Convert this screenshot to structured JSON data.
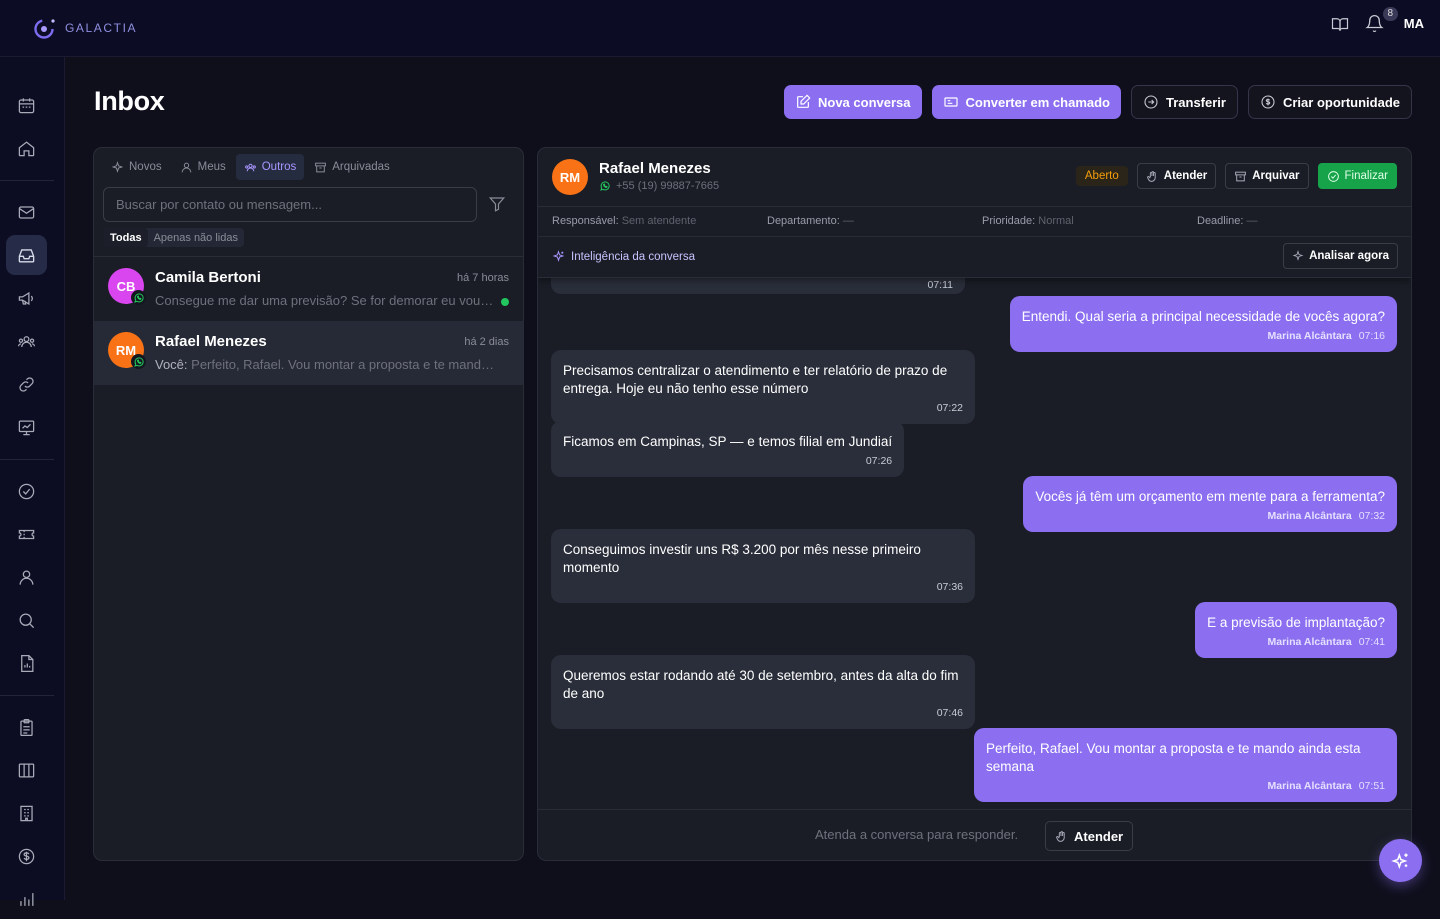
{
  "app": {
    "brand": "GALACTIA"
  },
  "topbar": {
    "notification_count": "8",
    "user_initials": "MA"
  },
  "page": {
    "title": "Inbox"
  },
  "actions": {
    "new_conversation": "Nova conversa",
    "convert_ticket": "Converter em chamado",
    "transfer": "Transferir",
    "create_opportunity": "Criar oportunidade"
  },
  "inbox": {
    "tabs": [
      {
        "label": "Novos",
        "icon": "sparkle-icon"
      },
      {
        "label": "Meus",
        "icon": "user-icon"
      },
      {
        "label": "Outros",
        "icon": "users-icon"
      },
      {
        "label": "Arquivadas",
        "icon": "archive-icon"
      }
    ],
    "active_tab": "Outros",
    "search_placeholder": "Buscar por contato ou mensagem...",
    "filters": {
      "all": "Todas",
      "unread": "Apenas não lidas"
    },
    "conversations": [
      {
        "initials": "CB",
        "name": "Camila Bertoni",
        "time": "há 7 horas",
        "preview_prefix": "",
        "preview": "Consegue me dar uma previsão? Se for demorar eu vou procurar outra opção",
        "unread": true,
        "avatar_color": "#d946ef",
        "channel": "whatsapp-icon"
      },
      {
        "initials": "RM",
        "name": "Rafael Menezes",
        "time": "há 2 dias",
        "preview_prefix": "Você:",
        "preview": " Perfeito, Rafael. Vou montar a proposta e te mando ainda esta semana",
        "unread": false,
        "avatar_color": "#f97316",
        "channel": "whatsapp-icon"
      }
    ]
  },
  "chat": {
    "contact": {
      "initials": "RM",
      "name": "Rafael Menezes",
      "phone": "+55 (19) 99887-7665"
    },
    "status": "Aberto",
    "buttons": {
      "attend": "Atender",
      "archive": "Arquivar",
      "finish": "Finalizar"
    },
    "meta": [
      {
        "label": "Responsável:",
        "value": "Sem atendente"
      },
      {
        "label": "Departamento:",
        "value": "—"
      },
      {
        "label": "Prioridade:",
        "value": "Normal"
      },
      {
        "label": "Deadline:",
        "value": "—"
      }
    ],
    "intel": {
      "label": "Inteligência da conversa",
      "button": "Analisar agora"
    },
    "messages": [
      {
        "dir": "in",
        "text": "",
        "time": "07:11"
      },
      {
        "dir": "out",
        "text": "Entendi. Qual seria a principal necessidade de vocês agora?",
        "author": "Marina Alcântara",
        "time": "07:16"
      },
      {
        "dir": "in",
        "text": "Precisamos centralizar o atendimento e ter relatório de prazo de entrega. Hoje eu não tenho esse número",
        "time": "07:22"
      },
      {
        "dir": "in",
        "text": "Ficamos em Campinas, SP — e temos filial em Jundiaí",
        "time": "07:26"
      },
      {
        "dir": "out",
        "text": "Vocês já têm um orçamento em mente para a ferramenta?",
        "author": "Marina Alcântara",
        "time": "07:32"
      },
      {
        "dir": "in",
        "text": "Conseguimos investir uns R$ 3.200 por mês nesse primeiro momento",
        "time": "07:36"
      },
      {
        "dir": "out",
        "text": "E a previsão de implantação?",
        "author": "Marina Alcântara",
        "time": "07:41"
      },
      {
        "dir": "in",
        "text": "Queremos estar rodando até 30 de setembro, antes da alta do fim de ano",
        "time": "07:46"
      },
      {
        "dir": "out",
        "text": "Perfeito, Rafael. Vou montar a proposta e te mando ainda esta semana",
        "author": "Marina Alcântara",
        "time": "07:51"
      }
    ],
    "composer": {
      "hint": "Atenda a conversa para responder.",
      "button": "Atender"
    }
  },
  "colors": {
    "accent": "#8b6ff0",
    "open_badge": "#f59e0b",
    "finish": "#16a34a",
    "unread_dot": "#22c55e"
  }
}
